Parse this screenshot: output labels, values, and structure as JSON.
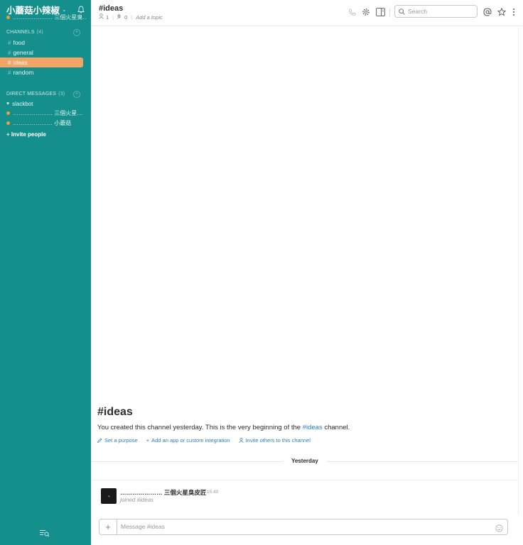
{
  "sidebar": {
    "team_name": "小蘑菇小辣椒",
    "user_name": "………………… 三個火星臭…",
    "channels_header": "CHANNELS",
    "channels_count": "(4)",
    "channels": [
      {
        "label": "food"
      },
      {
        "label": "general"
      },
      {
        "label": "ideas"
      },
      {
        "label": "random"
      }
    ],
    "dm_header": "DIRECT MESSAGES",
    "dm_count": "(3)",
    "dms": [
      {
        "label": "slackbot"
      },
      {
        "label": "………………… 三個火星…"
      },
      {
        "label": "………………… 小蘑菇"
      }
    ],
    "invite_label": "+ Invite people"
  },
  "header": {
    "channel_title": "#ideas",
    "members_count": "1",
    "pinned_count": "0",
    "topic_placeholder": "Add a topic",
    "search_placeholder": "Search"
  },
  "intro": {
    "title": "#ideas",
    "text_before": "You created this channel yesterday. This is the very beginning of the ",
    "channel_link": "#ideas",
    "text_after": " channel.",
    "action_purpose": "Set a purpose",
    "action_app": "Add an app or custom integration",
    "action_invite": "Invite others to this channel"
  },
  "messages": {
    "day_label": "Yesterday",
    "items": [
      {
        "author": "………………… 三個火星臭皮匠",
        "time": "15:40",
        "text": "joined #ideas"
      }
    ]
  },
  "composer": {
    "placeholder": "Message #ideas"
  },
  "colors": {
    "sidebar_bg": "#148f8c",
    "active_channel": "#f2a567",
    "link": "#2a80b9"
  }
}
